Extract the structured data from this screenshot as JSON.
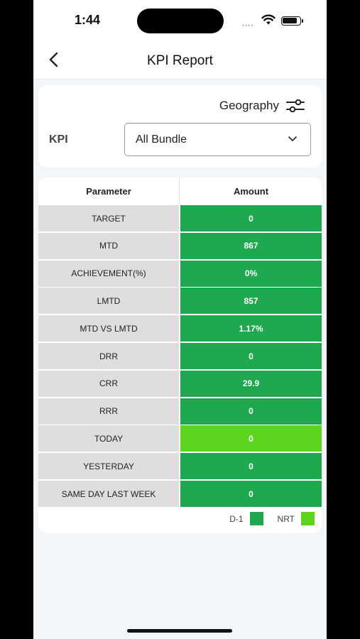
{
  "status_bar": {
    "time": "1:44"
  },
  "nav": {
    "title": "KPI Report"
  },
  "filters": {
    "geography_label": "Geography",
    "kpi_label": "KPI",
    "kpi_selected": "All Bundle"
  },
  "table": {
    "headers": {
      "parameter": "Parameter",
      "amount": "Amount"
    },
    "rows": [
      {
        "parameter": "TARGET",
        "amount": "0",
        "type": "d1"
      },
      {
        "parameter": "MTD",
        "amount": "867",
        "type": "d1"
      },
      {
        "parameter": "ACHIEVEMENT(%)",
        "amount": "0%",
        "type": "d1"
      },
      {
        "parameter": "LMTD",
        "amount": "857",
        "type": "d1"
      },
      {
        "parameter": "MTD VS LMTD",
        "amount": "1.17%",
        "type": "d1"
      },
      {
        "parameter": "DRR",
        "amount": "0",
        "type": "d1"
      },
      {
        "parameter": "CRR",
        "amount": "29.9",
        "type": "d1"
      },
      {
        "parameter": "RRR",
        "amount": "0",
        "type": "d1"
      },
      {
        "parameter": "TODAY",
        "amount": "0",
        "type": "nrt"
      },
      {
        "parameter": "YESTERDAY",
        "amount": "0",
        "type": "d1"
      },
      {
        "parameter": "SAME DAY LAST WEEK",
        "amount": "0",
        "type": "d1"
      }
    ]
  },
  "legend": {
    "d1_label": "D-1",
    "nrt_label": "NRT"
  },
  "colors": {
    "d1": "#1fa84f",
    "nrt": "#5dd51e",
    "param_bg": "#dedede"
  },
  "icons": {
    "back": "chevron-left-icon",
    "geography": "sliders-icon",
    "dropdown": "chevron-down-icon"
  }
}
